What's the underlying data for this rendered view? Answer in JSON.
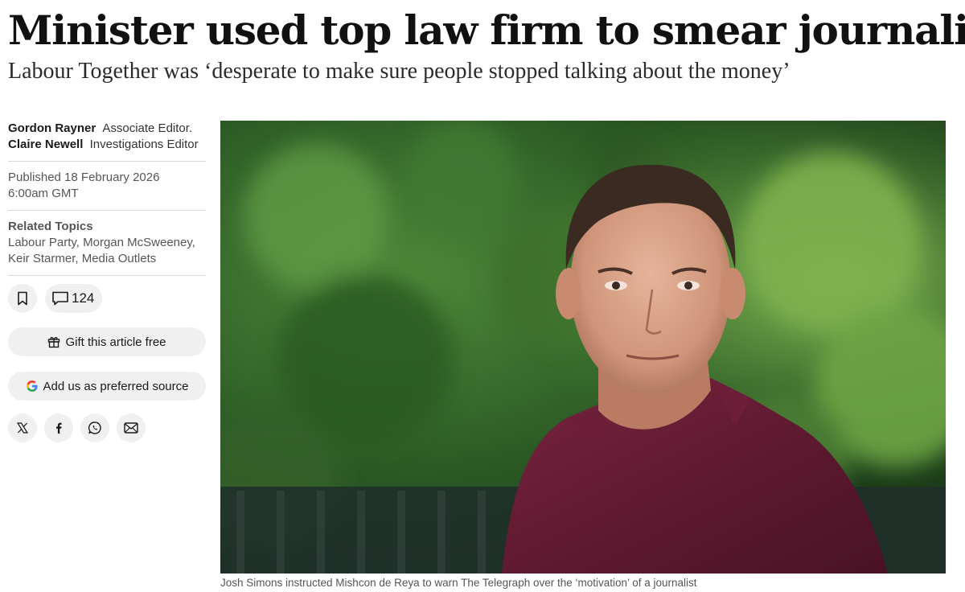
{
  "article": {
    "headline": "Minister used top law firm to smear journalist",
    "standfirst": "Labour Together was ‘desperate to make sure people stopped talking about the money’"
  },
  "authors": [
    {
      "name": "Gordon Rayner",
      "role": "Associate Editor."
    },
    {
      "name": "Claire Newell",
      "role": "Investigations Editor"
    }
  ],
  "published": {
    "date_line": "Published 18 February 2026",
    "time_line": "6:00am GMT"
  },
  "related_topics": {
    "title": "Related Topics",
    "items": [
      "Labour Party",
      "Morgan McSweeney",
      "Keir Starmer",
      "Media Outlets"
    ]
  },
  "actions": {
    "comment_count": "124",
    "gift_label": "Gift this article free",
    "preferred_source_label": "Add us as preferred source"
  },
  "share_icons": [
    "x-icon",
    "facebook-icon",
    "whatsapp-icon",
    "email-icon"
  ],
  "image": {
    "caption": "Josh Simons instructed Mishcon de Reya to warn The Telegraph over the ‘motivation’ of a journalist"
  },
  "colors": {
    "google_blue": "#4285F4",
    "google_red": "#EA4335",
    "google_yellow": "#FBBC05",
    "google_green": "#34A853"
  }
}
